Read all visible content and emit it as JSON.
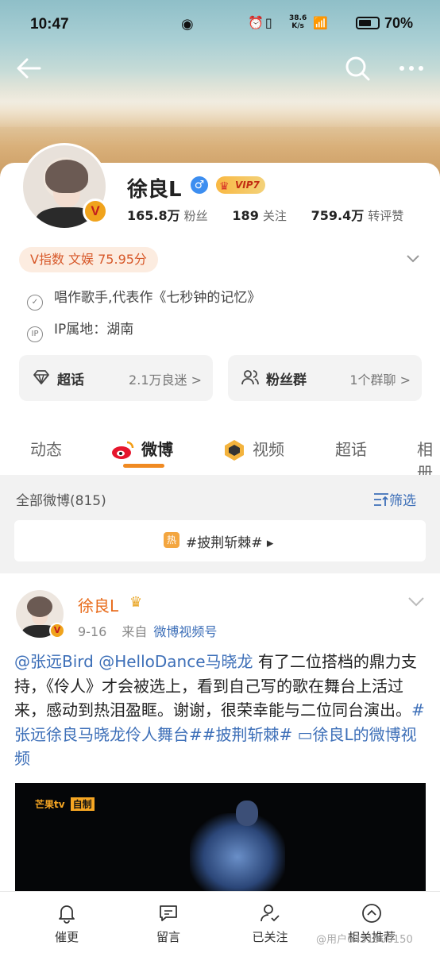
{
  "status_bar": {
    "time": "10:47",
    "speed_value": "38.6",
    "speed_unit": "K/s",
    "battery": "70%",
    "battery_level": 0.7
  },
  "profile": {
    "name": "徐良L",
    "gender_symbol": "♂",
    "vip_label": "VIP7",
    "verified_mark": "V",
    "stats": {
      "followers_value": "165.8万",
      "followers_label": "粉丝",
      "following_value": "189",
      "following_label": "关注",
      "likes_value": "759.4万",
      "likes_label": "转评赞"
    },
    "v_index": "V指数 文娱 75.95分",
    "bio": "唱作歌手,代表作《七秒钟的记忆》",
    "ip_location": "IP属地：湖南",
    "ip_icon_text": "IP"
  },
  "cards": {
    "supertopic": {
      "title": "超话",
      "sub": "2.1万良迷 >"
    },
    "fangroup": {
      "title": "粉丝群",
      "sub": "1个群聊 >"
    }
  },
  "tabs": [
    "动态",
    "微博",
    "视频",
    "超话",
    "相册"
  ],
  "feed_header": {
    "all_label": "全部微博(815)",
    "filter_label": "筛选"
  },
  "hot_topic": {
    "badge": "热",
    "text": "#披荆斩棘# ▸"
  },
  "post": {
    "author": "徐良L",
    "date": "9-16",
    "source_prefix": "来自",
    "source": "微博视频号",
    "mention1": "@张远Bird",
    "mention2": "@HelloDance马晓龙",
    "body": " 有了二位搭档的鼎力支持，《伶人》才会被选上，看到自己写的歌在舞台上活过来，感动到热泪盈眶。谢谢，很荣幸能与二位同台演出。",
    "hashtag1": "#张远徐良马晓龙伶人舞台##披荆斩棘#",
    "video_link": " ▭徐良L的微博视频",
    "video_logo": "芒果tv",
    "video_logo_tag": "自制"
  },
  "bottom_bar": {
    "remind": "催更",
    "message": "留言",
    "followed": "已关注",
    "related": "相关推荐"
  },
  "watermark": "@用户6431900150",
  "colors": {
    "accent": "#f08a22",
    "link": "#3d6fb8",
    "name_orange": "#e86b1b"
  }
}
